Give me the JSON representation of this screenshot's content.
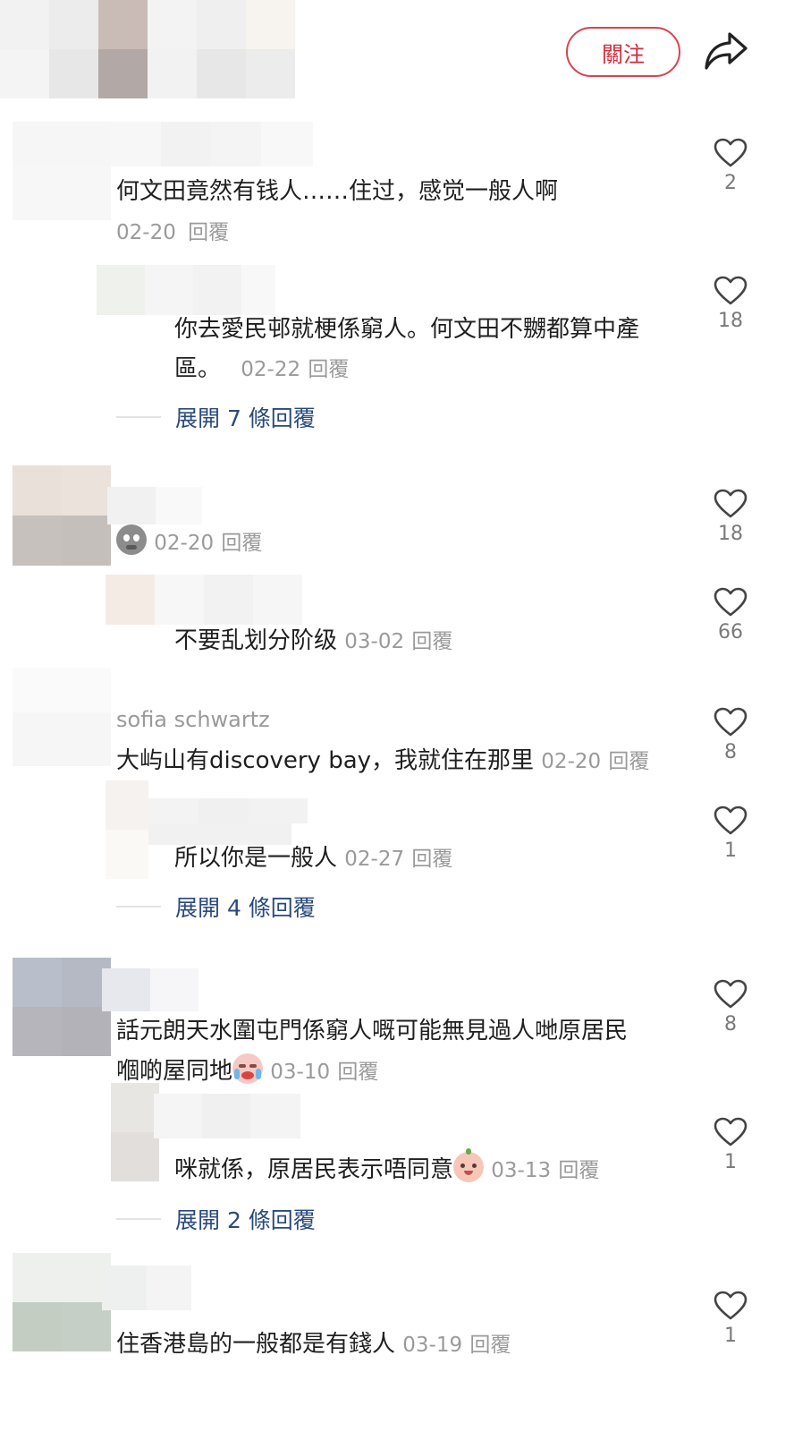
{
  "header": {
    "follow_label": "關注",
    "share_icon": "share-icon"
  },
  "comments": [
    {
      "text": "何文田竟然有钱人……住过，感觉一般人啊",
      "date": "02-20",
      "reply": "回覆",
      "likes": "2",
      "replies": [
        {
          "text_line1": "你去愛民邨就梗係窮人。何文田不嬲都算中產",
          "text_line2": "區。",
          "date": "02-22",
          "reply": "回覆",
          "likes": "18"
        }
      ],
      "expand_label": "展開 7 條回覆"
    },
    {
      "emoji": "skull-face-emoji",
      "date": "02-20",
      "reply": "回覆",
      "likes": "18",
      "replies": [
        {
          "text": "不要乱划分阶级",
          "date": "03-02",
          "reply": "回覆",
          "likes": "66"
        }
      ]
    },
    {
      "username": "sofia schwartz",
      "text": "大屿山有discovery bay，我就住在那里",
      "date": "02-20",
      "reply": "回覆",
      "likes": "8",
      "replies": [
        {
          "text": "所以你是一般人",
          "date": "02-27",
          "reply": "回覆",
          "likes": "1"
        }
      ],
      "expand_label": "展開 4 條回覆"
    },
    {
      "text_line1": "話元朗天水圍屯門係窮人嘅可能無見過人哋原居民",
      "text_line2": "嗰啲屋同地",
      "emoji": "crying-face-emoji",
      "date": "03-10",
      "reply": "回覆",
      "likes": "8",
      "replies": [
        {
          "text": "咪就係，原居民表示唔同意",
          "emoji": "smiling-face-emoji",
          "date": "03-13",
          "reply": "回覆",
          "likes": "1"
        }
      ],
      "expand_label": "展開 2 條回覆"
    },
    {
      "text": "住香港島的一般都是有錢人",
      "date": "03-19",
      "reply": "回覆",
      "likes": "1"
    }
  ]
}
